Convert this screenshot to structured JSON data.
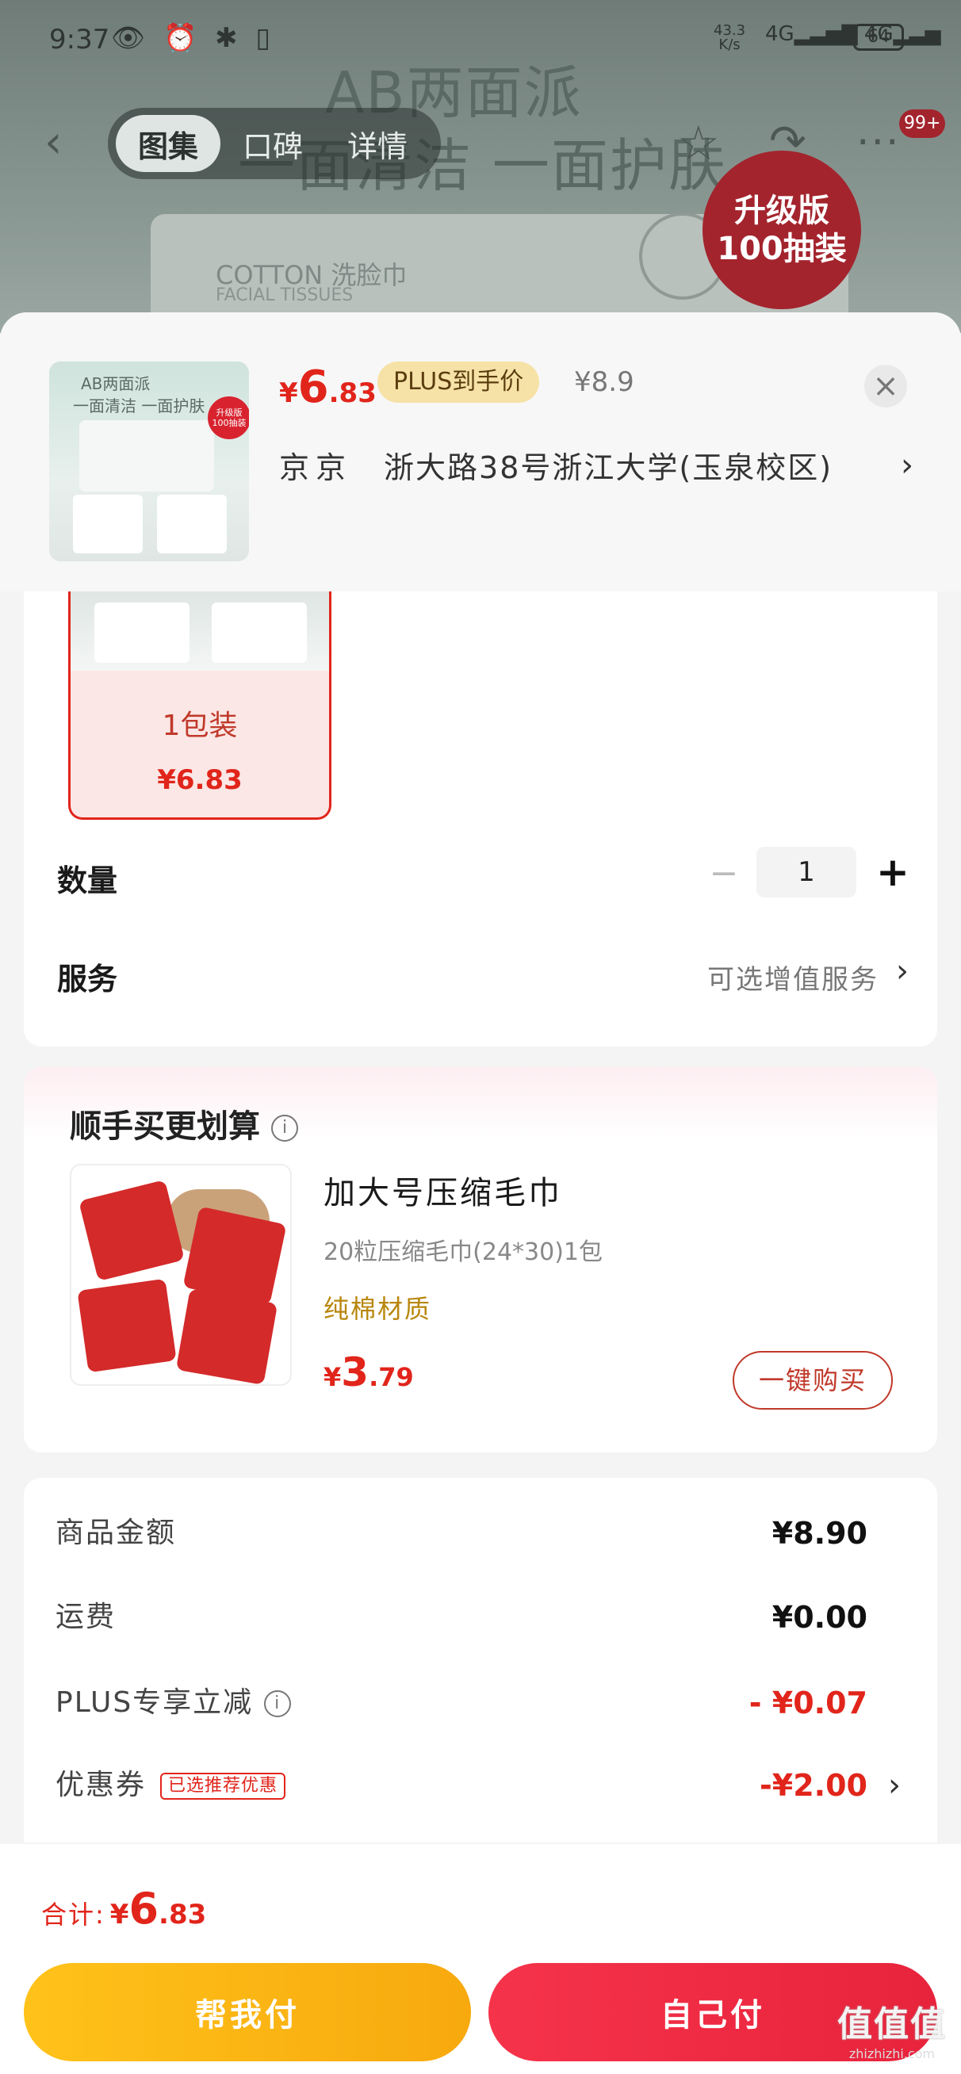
{
  "status_bar": {
    "time": "9:37",
    "icons": "👁 ⏰ ✱ ▯",
    "net_speed_value": "43.3",
    "net_speed_unit": "K/s",
    "signal": "4G▂▃▅▇ 4G▂▃▅",
    "battery": "64"
  },
  "background": {
    "title_line1": "AB两面派",
    "title_line2": "一面清洁 一面护肤",
    "cotton": "COTTON 洗脸巾",
    "facial": "FACIAL TISSUES",
    "badge_line1": "升级版",
    "badge_line2": "100抽装"
  },
  "nav": {
    "back": "‹",
    "tabs": [
      {
        "label": "图集"
      },
      {
        "label": "口碑"
      },
      {
        "label": "详情"
      }
    ],
    "star": "☆",
    "share": "↷",
    "more": "···",
    "badge": "99+"
  },
  "header": {
    "thumb_title1": "AB两面派",
    "thumb_title2": "一面清洁 一面护肤",
    "thumb_badge": "升级版 100抽装",
    "price_symbol": "¥",
    "price_int": "6",
    "price_dec": ".83",
    "plus_tag": "PLUS到手价",
    "original_price": "¥8.9",
    "close": "×",
    "address_city": "京京",
    "address": "浙大路38号浙江大学(玉泉校区)",
    "address_chevron": "›"
  },
  "sku": {
    "option_label": "1包装",
    "option_price": "¥6.83"
  },
  "quantity": {
    "label": "数量",
    "minus": "−",
    "value": "1",
    "plus": "+"
  },
  "service": {
    "label": "服务",
    "value": "可选增值服务",
    "chevron": "›"
  },
  "addon": {
    "title": "顺手买更划算",
    "info": "i",
    "name": "加大号压缩毛巾",
    "spec": "20粒压缩毛巾(24*30)1包",
    "feature": "纯棉材质",
    "price_symbol": "¥",
    "price_int": "3",
    "price_dec": ".79",
    "buy_label": "一键购买"
  },
  "summary": {
    "rows": [
      {
        "label": "商品金额",
        "value": "¥8.90"
      },
      {
        "label": "运费",
        "value": "¥0.00"
      },
      {
        "label": "PLUS专享立减",
        "value": "- ¥0.07"
      },
      {
        "label": "优惠券",
        "value": "-¥2.00"
      }
    ],
    "info": "i",
    "coupon_tag": "已选推荐优惠",
    "chevron": "›"
  },
  "bottom": {
    "total_label": "合计:",
    "total_symbol": "¥",
    "total_int": "6",
    "total_dec": ".83",
    "help_pay": "帮我付",
    "self_pay": "自己付",
    "watermark": "值值值",
    "watermark_url": "zhizhizhi.com"
  },
  "colors": {
    "price_red": "#e1251b",
    "plus_gold": "#f6e2a6",
    "help_pay_yellow": "#ffc21a",
    "self_pay_red": "#f5334a"
  }
}
